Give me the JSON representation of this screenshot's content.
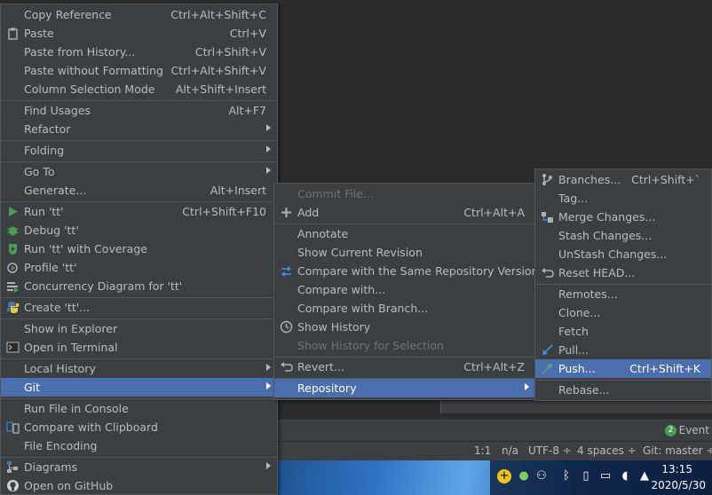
{
  "main_menu": [
    {
      "label": "Copy Reference",
      "shortcut": "Ctrl+Alt+Shift+C"
    },
    {
      "label": "Paste",
      "shortcut": "Ctrl+V",
      "icon": "clipboard-icon"
    },
    {
      "label": "Paste from History...",
      "shortcut": "Ctrl+Shift+V"
    },
    {
      "label": "Paste without Formatting",
      "shortcut": "Ctrl+Alt+Shift+V"
    },
    {
      "label": "Column Selection Mode",
      "shortcut": "Alt+Shift+Insert"
    },
    {
      "label": "Find Usages",
      "shortcut": "Alt+F7"
    },
    {
      "label": "Refactor",
      "submenu": true
    },
    {
      "label": "Folding",
      "submenu": true
    },
    {
      "label": "Go To",
      "submenu": true
    },
    {
      "label": "Generate...",
      "shortcut": "Alt+Insert"
    },
    {
      "label": "Run 'tt'",
      "shortcut": "Ctrl+Shift+F10",
      "icon": "run-icon"
    },
    {
      "label": "Debug 'tt'",
      "icon": "debug-icon"
    },
    {
      "label": "Run 'tt' with Coverage",
      "icon": "coverage-icon"
    },
    {
      "label": "Profile 'tt'",
      "icon": "profile-icon"
    },
    {
      "label": "Concurrency Diagram for 'tt'",
      "icon": "concurrency-icon"
    },
    {
      "label": "Create 'tt'...",
      "icon": "python-icon"
    },
    {
      "label": "Show in Explorer"
    },
    {
      "label": "Open in Terminal",
      "icon": "terminal-icon"
    },
    {
      "label": "Local History",
      "submenu": true
    },
    {
      "label": "Git",
      "submenu": true
    },
    {
      "label": "Run File in Console"
    },
    {
      "label": "Compare with Clipboard",
      "icon": "compare-icon"
    },
    {
      "label": "File Encoding"
    },
    {
      "label": "Diagrams",
      "submenu": true,
      "icon": "diagram-icon"
    },
    {
      "label": "Open on GitHub",
      "icon": "github-icon"
    }
  ],
  "git_menu": [
    {
      "label": "Commit File...",
      "disabled": true
    },
    {
      "label": "Add",
      "shortcut": "Ctrl+Alt+A",
      "icon": "plus-icon"
    },
    {
      "label": "Annotate"
    },
    {
      "label": "Show Current Revision"
    },
    {
      "label": "Compare with the Same Repository Version",
      "icon": "compare-arrows-icon"
    },
    {
      "label": "Compare with..."
    },
    {
      "label": "Compare with Branch..."
    },
    {
      "label": "Show History",
      "icon": "clock-icon"
    },
    {
      "label": "Show History for Selection",
      "disabled": true
    },
    {
      "label": "Revert...",
      "shortcut": "Ctrl+Alt+Z",
      "icon": "revert-icon"
    },
    {
      "label": "Repository",
      "submenu": true
    }
  ],
  "repo_menu": [
    {
      "label": "Branches...",
      "shortcut": "Ctrl+Shift+`",
      "icon": "branch-icon"
    },
    {
      "label": "Tag..."
    },
    {
      "label": "Merge Changes...",
      "icon": "merge-icon"
    },
    {
      "label": "Stash Changes..."
    },
    {
      "label": "UnStash Changes..."
    },
    {
      "label": "Reset HEAD...",
      "icon": "reset-icon"
    },
    {
      "label": "Remotes..."
    },
    {
      "label": "Clone..."
    },
    {
      "label": "Fetch"
    },
    {
      "label": "Pull...",
      "icon": "pull-arrow-icon"
    },
    {
      "label": "Push...",
      "shortcut": "Ctrl+Shift+K",
      "icon": "push-arrow-icon"
    },
    {
      "label": "Rebase..."
    }
  ],
  "event_log": {
    "count": "2",
    "label": "Event"
  },
  "status_bar": {
    "position": "1:1",
    "na": "n/a",
    "encoding": "UTF-8 ÷",
    "indent": "4 spaces ÷",
    "git": "Git: master ÷"
  },
  "taskbar": {
    "time": "13:15",
    "date": "2020/5/30"
  }
}
